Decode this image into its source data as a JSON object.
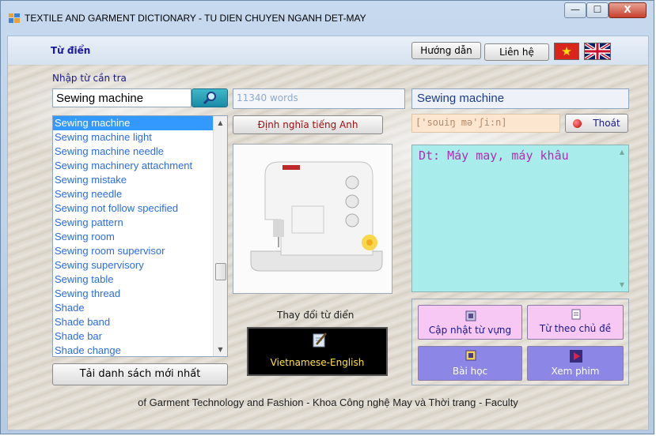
{
  "window": {
    "title": "TEXTILE AND GARMENT DICTIONARY - TU DIEN CHUYEN NGANH DET-MAY",
    "controls": {
      "minimize": "—",
      "maximize": "☐",
      "close": "X"
    }
  },
  "menubar": {
    "title": "Từ điển",
    "help_label": "Hướng dẫn",
    "contact_label": "Liên hệ"
  },
  "search": {
    "label": "Nhập từ cần tra",
    "value": "Sewing machine",
    "icon": "magnifier-icon"
  },
  "word_count": "11340 words",
  "english_def_button": "Định nghĩa tiếng Anh",
  "headword": "Sewing machine",
  "pronunciation": "['souiŋ mə'ʃi:n]",
  "exit_label": "Thoát",
  "definition": "Dt: Máy may, máy khâu",
  "word_list": [
    "Sewing machine",
    "Sewing machine light",
    "Sewing machine needle",
    "Sewing machinery attachment",
    "Sewing mistake",
    "Sewing needle",
    "Sewing not follow specified",
    "Sewing pattern",
    "Sewing room",
    "Sewing room supervisor",
    "Sewing supervisory",
    "Sewing table",
    "Sewing thread",
    "Shade",
    "Shade band",
    "Shade bar",
    "Shade change"
  ],
  "selected_index": 0,
  "refresh_list_button": "Tải danh sách mới nhất",
  "change_dictionary": {
    "label": "Thay đổi từ điển",
    "current": "Vietnamese-English"
  },
  "actions": {
    "update_vocab": "Cập nhật từ vựng",
    "topics": "Từ theo chủ đề",
    "lessons": "Bài học",
    "videos": "Xem phim"
  },
  "footer": "of Garment Technology and Fashion - Khoa Công nghệ May và Thời trang - Faculty",
  "colors": {
    "accent_blue": "#3399ff",
    "definition_bg": "#a8ecec",
    "action_pink": "#f7c8f4",
    "action_purple": "#8c86e6",
    "dict_box": "#000000"
  }
}
